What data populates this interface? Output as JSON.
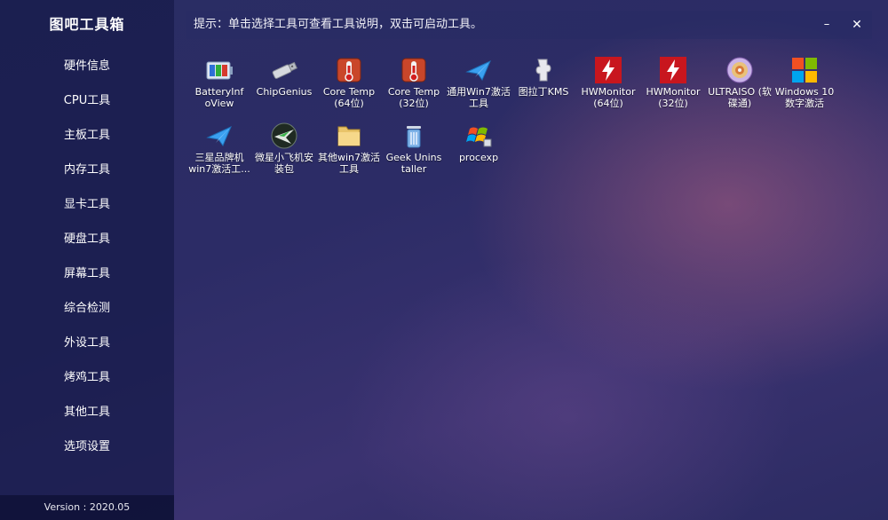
{
  "app": {
    "title": "图吧工具箱",
    "version": "Version : 2020.05"
  },
  "sidebar": {
    "items": [
      {
        "label": "硬件信息"
      },
      {
        "label": "CPU工具"
      },
      {
        "label": "主板工具"
      },
      {
        "label": "内存工具"
      },
      {
        "label": "显卡工具"
      },
      {
        "label": "硬盘工具"
      },
      {
        "label": "屏幕工具"
      },
      {
        "label": "综合检测"
      },
      {
        "label": "外设工具"
      },
      {
        "label": "烤鸡工具"
      },
      {
        "label": "其他工具"
      },
      {
        "label": "选项设置"
      }
    ]
  },
  "header": {
    "hint": "提示：单击选择工具可查看工具说明，双击可启动工具。",
    "minimize": "–",
    "close": "✕"
  },
  "tools": [
    {
      "label": "BatteryInf\noView",
      "icon": "battery-icon"
    },
    {
      "label": "ChipGenius",
      "icon": "usb-drive-icon"
    },
    {
      "label": "Core Temp\n(64位)",
      "icon": "thermometer-icon"
    },
    {
      "label": "Core Temp\n(32位)",
      "icon": "thermometer-icon"
    },
    {
      "label": "通用Win7激活\n工具",
      "icon": "paper-plane-icon"
    },
    {
      "label": "图拉丁KMS",
      "icon": "puzzle-icon"
    },
    {
      "label": "HWMonitor\n(64位)",
      "icon": "hwmonitor-icon"
    },
    {
      "label": "HWMonitor\n(32位)",
      "icon": "hwmonitor-icon"
    },
    {
      "label": "ULTRAISO (软\n碟通)",
      "icon": "disc-icon"
    },
    {
      "label": "Windows 10\n数字激活",
      "icon": "windows-logo-icon"
    },
    {
      "label": "三星品牌机\nwin7激活工...",
      "icon": "paper-plane-icon"
    },
    {
      "label": "微星小飞机安\n装包",
      "icon": "afterburner-icon"
    },
    {
      "label": "其他win7激活\n工具",
      "icon": "folder-icon"
    },
    {
      "label": "Geek Unins\ntaller",
      "icon": "trash-icon"
    },
    {
      "label": "procexp",
      "icon": "process-explorer-icon"
    }
  ]
}
